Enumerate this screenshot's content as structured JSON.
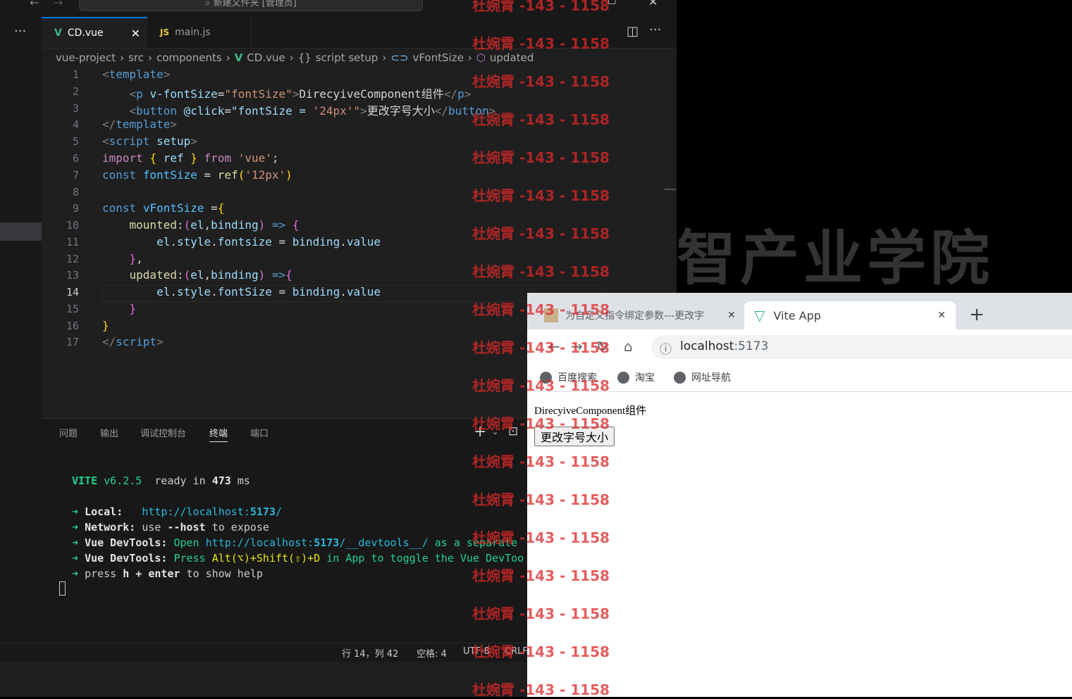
{
  "titlebar": {
    "search": "新建文件夹 [管理员]"
  },
  "editor_tabs": [
    {
      "label": "CD.vue",
      "icon": "V",
      "active": true
    },
    {
      "label": "main.js",
      "icon": "JS",
      "active": false
    }
  ],
  "breadcrumb": [
    "vue-project",
    "src",
    "components",
    "CD.vue",
    "script setup",
    "vFontSize",
    "updated"
  ],
  "breadcrumb_icons": {
    "vue": "V",
    "braces": "{}"
  },
  "line_numbers": [
    "1",
    "2",
    "3",
    "4",
    "5",
    "6",
    "7",
    "8",
    "9",
    "10",
    "11",
    "12",
    "13",
    "14",
    "15",
    "16",
    "17"
  ],
  "code": {
    "l1": [
      "<",
      "template",
      ">"
    ],
    "l2": [
      "<",
      "p",
      "v-fontSize",
      "=",
      "\"fontSize\"",
      ">",
      "DirecyiveComponent组件",
      "</",
      "p",
      ">"
    ],
    "l3": [
      "<",
      "button",
      "@click",
      "=",
      "\"fontSize = ",
      "'24px'",
      "\"",
      ">",
      "更改字号大小",
      "</",
      "button",
      ">"
    ],
    "l4": [
      "</",
      "template",
      ">"
    ],
    "l5": [
      "<",
      "script",
      "setup",
      ">"
    ],
    "l6": [
      "import",
      "{",
      "ref",
      "}",
      "from",
      "'vue'",
      ";"
    ],
    "l7": [
      "const",
      "fontSize",
      "=",
      "ref",
      "(",
      "'12px'",
      ")"
    ],
    "l9": [
      "const",
      "vFontSize",
      "=",
      "{"
    ],
    "l10": [
      "mounted",
      ":",
      "(",
      "el",
      ",",
      "binding",
      ")",
      "=>",
      "{"
    ],
    "l11": [
      "el",
      ".",
      "style",
      ".",
      "fontsize",
      "=",
      "binding",
      ".",
      "value"
    ],
    "l12": [
      "}",
      ","
    ],
    "l13": [
      "updated",
      ":",
      "(",
      "el",
      ",",
      "binding",
      ")",
      "=>",
      "{"
    ],
    "l14": [
      "el",
      ".",
      "style",
      ".",
      "fontSize",
      "=",
      "binding",
      ".",
      "value"
    ],
    "l15": [
      "}"
    ],
    "l16": [
      "}"
    ],
    "l17": [
      "</",
      "script",
      ">"
    ]
  },
  "panel_tabs": [
    "问题",
    "输出",
    "调试控制台",
    "终端",
    "端口"
  ],
  "terminal": {
    "vite": "VITE",
    "version": "v6.2.5",
    "ready": "ready in",
    "ms_value": "473",
    "ms": "ms",
    "arrow": "➜",
    "local_label": "Local:",
    "local_url_a": "http://localhost:",
    "local_url_b": "5173",
    "local_url_c": "/",
    "network_label": "Network:",
    "network_a": "use",
    "network_b": "--host",
    "network_c": "to expose",
    "devtools_label": "Vue DevTools:",
    "devtools1_a": "Open",
    "devtools1_b": "http://localhost:",
    "devtools1_c": "5173",
    "devtools1_d": "/__devtools__/",
    "devtools1_e": "as a separate",
    "devtools2_a": "Press",
    "devtools2_b": "Alt(⌥)+Shift(⇧)+D",
    "devtools2_c": "in App to toggle the Vue DevToo",
    "help_a": "press",
    "help_b": "h + enter",
    "help_c": "to show help"
  },
  "statusbar": {
    "position": "行 14，列 42",
    "spaces": "空格: 4",
    "encoding": "UTF-8",
    "eol": "CRLF"
  },
  "background_text": "智产业学院",
  "browser": {
    "tabs": [
      {
        "label": "为自定义指令绑定参数---更改字",
        "active": false
      },
      {
        "label": "Vite App",
        "active": true
      }
    ],
    "url_host": "localhost",
    "url_port": ":5173",
    "bookmarks": [
      "百度搜索",
      "淘宝",
      "网址导航"
    ],
    "page_text": "DirecyiveComponent组件",
    "page_button": "更改字号大小"
  },
  "watermark": "杜婉霄 -143 - 1158",
  "colors": {
    "accent": "#0078d4",
    "vue_green": "#41b883",
    "js_yellow": "#f1e05a",
    "watermark": "#dc2828"
  }
}
